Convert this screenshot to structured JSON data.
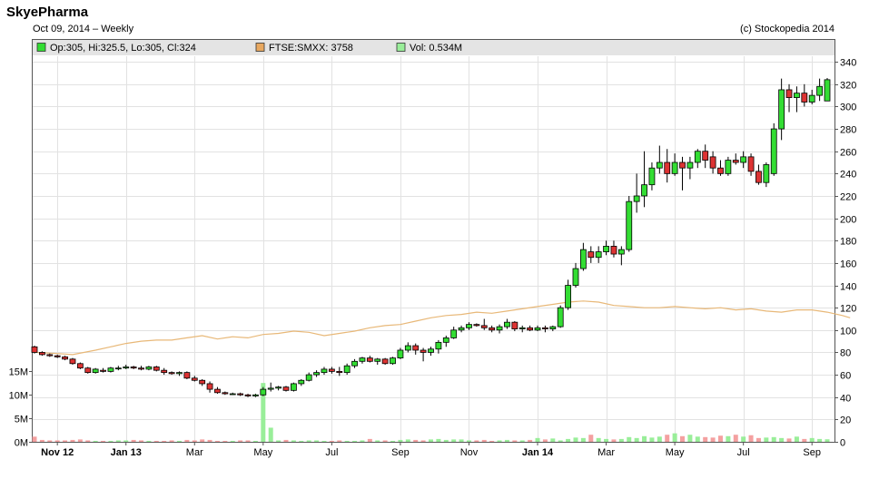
{
  "header": {
    "title": "SkyePharma",
    "subtitle": "Oct 09, 2014  – Weekly",
    "copyright": "(c) Stockopedia 2014"
  },
  "colors": {
    "up": "#33dd33",
    "down": "#dd3333",
    "vol_up": "#99ee99",
    "vol_down": "#f4a0a0",
    "index_line": "#e8b878",
    "legend_bg": "#e4e4e4",
    "grid": "#e2e2e2"
  },
  "chart_data": {
    "type": "candlestick",
    "legend": [
      {
        "text": "Op:305, Hi:325.5, Lo:305, Cl:324",
        "color": "#33dd33"
      },
      {
        "text": "FTSE:SMXX: 3758",
        "color": "#e8a860"
      },
      {
        "text": "Vol: 0.534M",
        "color": "#99ee99"
      }
    ],
    "price_axis": {
      "min": 0,
      "max": 345,
      "ticks": [
        0,
        20,
        40,
        60,
        80,
        100,
        120,
        140,
        160,
        180,
        200,
        220,
        240,
        260,
        280,
        300,
        320,
        340
      ]
    },
    "volume_axis": {
      "min": 0,
      "max": 16,
      "ticks": [
        0,
        5,
        10,
        15
      ],
      "labels": [
        "0M",
        "5M",
        "10M",
        "15M"
      ]
    },
    "x_ticks": [
      {
        "label": "Nov 12",
        "week": 3,
        "bold": true
      },
      {
        "label": "Jan 13",
        "week": 12,
        "bold": true
      },
      {
        "label": "Mar",
        "week": 21,
        "bold": false
      },
      {
        "label": "May",
        "week": 30,
        "bold": false
      },
      {
        "label": "Jul",
        "week": 39,
        "bold": false
      },
      {
        "label": "Sep",
        "week": 48,
        "bold": false
      },
      {
        "label": "Nov",
        "week": 57,
        "bold": false
      },
      {
        "label": "Jan 14",
        "week": 66,
        "bold": true
      },
      {
        "label": "Mar",
        "week": 75,
        "bold": false
      },
      {
        "label": "May",
        "week": 84,
        "bold": false
      },
      {
        "label": "Jul",
        "week": 93,
        "bold": false
      },
      {
        "label": "Sep",
        "week": 102,
        "bold": false
      }
    ],
    "candles": [
      [
        85,
        86,
        79,
        80
      ],
      [
        80,
        81,
        77,
        78
      ],
      [
        78,
        79,
        76,
        77
      ],
      [
        77,
        78,
        75,
        76
      ],
      [
        76,
        77,
        73,
        74
      ],
      [
        74,
        75,
        69,
        70
      ],
      [
        70,
        71,
        65,
        66
      ],
      [
        66,
        67,
        61,
        62
      ],
      [
        62,
        66,
        61,
        65
      ],
      [
        64,
        66,
        62,
        63
      ],
      [
        63,
        67,
        62,
        66
      ],
      [
        66,
        68,
        64,
        66
      ],
      [
        66,
        69,
        65,
        67
      ],
      [
        67,
        68,
        65,
        66
      ],
      [
        66,
        68,
        64,
        65
      ],
      [
        65,
        68,
        64,
        67
      ],
      [
        67,
        68,
        63,
        64
      ],
      [
        64,
        66,
        60,
        62
      ],
      [
        62,
        63,
        60,
        61
      ],
      [
        61,
        63,
        59,
        62
      ],
      [
        62,
        63,
        56,
        57
      ],
      [
        57,
        59,
        54,
        55
      ],
      [
        55,
        56,
        50,
        52
      ],
      [
        52,
        54,
        44,
        47
      ],
      [
        47,
        49,
        43,
        44
      ],
      [
        44,
        45,
        42,
        43
      ],
      [
        43,
        44,
        42,
        43
      ],
      [
        43,
        44,
        41,
        42
      ],
      [
        42,
        43,
        40,
        41
      ],
      [
        41,
        43,
        40,
        42
      ],
      [
        42,
        49,
        41,
        47
      ],
      [
        47,
        53,
        45,
        48
      ],
      [
        48,
        50,
        46,
        49
      ],
      [
        49,
        50,
        45,
        46
      ],
      [
        46,
        53,
        45,
        52
      ],
      [
        52,
        56,
        50,
        55
      ],
      [
        55,
        62,
        54,
        60
      ],
      [
        60,
        64,
        58,
        62
      ],
      [
        62,
        67,
        60,
        65
      ],
      [
        65,
        67,
        61,
        63
      ],
      [
        63,
        67,
        59,
        62
      ],
      [
        62,
        70,
        60,
        68
      ],
      [
        68,
        74,
        66,
        72
      ],
      [
        72,
        76,
        70,
        75
      ],
      [
        75,
        77,
        71,
        72
      ],
      [
        72,
        75,
        69,
        74
      ],
      [
        74,
        75,
        69,
        70
      ],
      [
        70,
        76,
        69,
        75
      ],
      [
        75,
        84,
        74,
        82
      ],
      [
        82,
        89,
        80,
        86
      ],
      [
        86,
        88,
        78,
        82
      ],
      [
        82,
        84,
        72,
        80
      ],
      [
        80,
        85,
        77,
        83
      ],
      [
        83,
        91,
        79,
        89
      ],
      [
        89,
        95,
        85,
        93
      ],
      [
        93,
        103,
        92,
        100
      ],
      [
        100,
        104,
        98,
        102
      ],
      [
        102,
        107,
        100,
        105
      ],
      [
        105,
        106,
        103,
        104
      ],
      [
        104,
        110,
        100,
        102
      ],
      [
        102,
        104,
        98,
        100
      ],
      [
        100,
        105,
        97,
        103
      ],
      [
        103,
        110,
        101,
        107
      ],
      [
        107,
        108,
        99,
        101
      ],
      [
        101,
        104,
        98,
        102
      ],
      [
        102,
        104,
        99,
        100
      ],
      [
        100,
        104,
        99,
        102
      ],
      [
        102,
        104,
        98,
        101
      ],
      [
        101,
        104,
        99,
        103
      ],
      [
        103,
        122,
        102,
        120
      ],
      [
        120,
        145,
        118,
        140
      ],
      [
        140,
        160,
        138,
        155
      ],
      [
        155,
        178,
        153,
        172
      ],
      [
        170,
        175,
        160,
        165
      ],
      [
        165,
        175,
        160,
        170
      ],
      [
        170,
        180,
        167,
        175
      ],
      [
        175,
        180,
        165,
        168
      ],
      [
        168,
        175,
        158,
        172
      ],
      [
        172,
        220,
        170,
        215
      ],
      [
        215,
        240,
        205,
        220
      ],
      [
        220,
        260,
        210,
        230
      ],
      [
        230,
        250,
        225,
        245
      ],
      [
        245,
        265,
        240,
        250
      ],
      [
        250,
        262,
        232,
        240
      ],
      [
        240,
        258,
        238,
        250
      ],
      [
        250,
        255,
        225,
        245
      ],
      [
        245,
        255,
        235,
        250
      ],
      [
        250,
        262,
        245,
        260
      ],
      [
        260,
        266,
        245,
        252
      ],
      [
        255,
        260,
        240,
        245
      ],
      [
        245,
        252,
        238,
        240
      ],
      [
        240,
        255,
        238,
        252
      ],
      [
        252,
        258,
        248,
        250
      ],
      [
        250,
        260,
        245,
        255
      ],
      [
        255,
        258,
        238,
        242
      ],
      [
        242,
        248,
        230,
        232
      ],
      [
        232,
        250,
        228,
        248
      ],
      [
        240,
        285,
        238,
        280
      ],
      [
        280,
        325,
        270,
        315
      ],
      [
        315,
        320,
        295,
        308
      ],
      [
        308,
        318,
        295,
        312
      ],
      [
        312,
        320,
        300,
        304
      ],
      [
        304,
        315,
        302,
        310
      ],
      [
        310,
        325,
        305,
        318
      ],
      [
        305,
        325.5,
        305,
        324
      ]
    ],
    "volume": [
      1.1,
      0.4,
      0.3,
      0.3,
      0.3,
      0.4,
      0.5,
      0.3,
      0.2,
      0.2,
      0.2,
      0.3,
      0.3,
      0.4,
      0.3,
      0.2,
      0.2,
      0.2,
      0.3,
      0.2,
      0.4,
      0.3,
      0.5,
      0.4,
      0.2,
      0.2,
      0.2,
      0.3,
      0.3,
      0.2,
      12.5,
      3.0,
      0.3,
      0.4,
      0.3,
      0.2,
      0.3,
      0.3,
      0.2,
      0.2,
      0.3,
      0.2,
      0.2,
      0.3,
      0.6,
      0.3,
      0.3,
      0.2,
      0.4,
      0.5,
      0.4,
      0.3,
      0.5,
      0.6,
      0.4,
      0.5,
      0.5,
      0.3,
      0.3,
      0.4,
      0.2,
      0.3,
      0.4,
      0.3,
      0.3,
      0.4,
      0.8,
      0.5,
      0.7,
      0.3,
      0.6,
      0.9,
      0.8,
      1.5,
      0.8,
      0.6,
      0.5,
      0.6,
      1.0,
      0.8,
      1.2,
      0.9,
      1.1,
      1.5,
      1.8,
      1.2,
      1.5,
      1.1,
      1.0,
      0.9,
      1.3,
      1.2,
      1.5,
      1.1,
      1.4,
      0.8,
      0.9,
      1.0,
      0.8,
      0.7,
      1.1,
      0.6,
      0.8,
      0.6,
      0.534
    ],
    "index_line": [
      [
        0,
        80
      ],
      [
        3,
        79
      ],
      [
        5,
        78
      ],
      [
        8,
        82
      ],
      [
        10,
        85
      ],
      [
        12,
        88
      ],
      [
        14,
        90
      ],
      [
        16,
        91
      ],
      [
        18,
        91
      ],
      [
        20,
        93
      ],
      [
        22,
        95
      ],
      [
        24,
        92
      ],
      [
        26,
        94
      ],
      [
        28,
        93
      ],
      [
        30,
        96
      ],
      [
        32,
        97
      ],
      [
        34,
        99
      ],
      [
        36,
        98
      ],
      [
        38,
        95
      ],
      [
        40,
        97
      ],
      [
        42,
        99
      ],
      [
        44,
        102
      ],
      [
        46,
        104
      ],
      [
        48,
        105
      ],
      [
        50,
        108
      ],
      [
        52,
        111
      ],
      [
        54,
        113
      ],
      [
        56,
        114
      ],
      [
        58,
        116
      ],
      [
        60,
        115
      ],
      [
        62,
        117
      ],
      [
        64,
        119
      ],
      [
        66,
        121
      ],
      [
        68,
        123
      ],
      [
        70,
        125
      ],
      [
        72,
        126
      ],
      [
        74,
        125
      ],
      [
        76,
        122
      ],
      [
        78,
        121
      ],
      [
        80,
        120
      ],
      [
        82,
        120
      ],
      [
        84,
        121
      ],
      [
        86,
        120
      ],
      [
        88,
        119
      ],
      [
        90,
        120
      ],
      [
        92,
        118
      ],
      [
        94,
        119
      ],
      [
        96,
        117
      ],
      [
        98,
        116
      ],
      [
        100,
        118
      ],
      [
        102,
        118
      ],
      [
        104,
        116
      ],
      [
        106,
        113
      ],
      [
        107,
        111
      ]
    ]
  }
}
